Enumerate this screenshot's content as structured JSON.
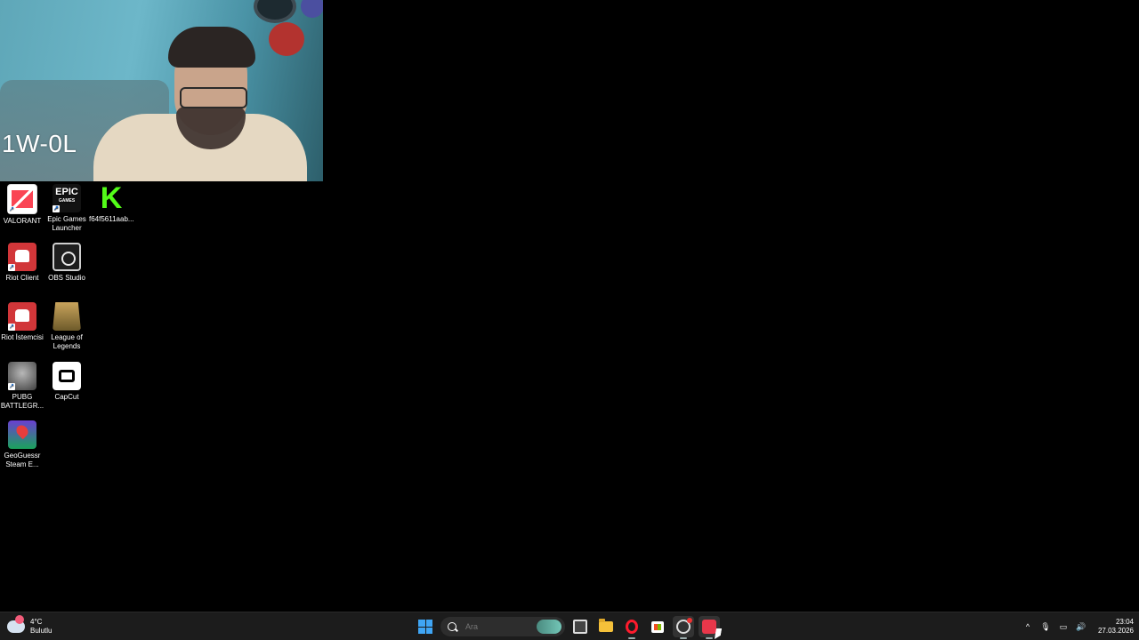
{
  "webcam": {
    "score_text": "1W-0L"
  },
  "desktop": {
    "icons": [
      {
        "label": "VALORANT",
        "icon": "valorant-icon"
      },
      {
        "label": "Epic Games Launcher",
        "icon": "epic-games-icon",
        "glyph": "EPIC",
        "subglyph": "GAMES"
      },
      {
        "label": "f64f5611aab...",
        "icon": "kick-icon",
        "glyph": "K"
      },
      {
        "label": "Riot Client",
        "icon": "riot-client-icon"
      },
      {
        "label": "OBS Studio",
        "icon": "obs-studio-icon"
      },
      {
        "label": "Riot İstemcisi",
        "icon": "riot-client-icon"
      },
      {
        "label": "League of Legends",
        "icon": "league-of-legends-icon"
      },
      {
        "label": "PUBG BATTLEGR...",
        "icon": "pubg-icon"
      },
      {
        "label": "CapCut",
        "icon": "capcut-icon"
      },
      {
        "label": "GeoGuessr Steam E...",
        "icon": "geoguessr-icon"
      }
    ]
  },
  "taskbar": {
    "weather": {
      "temp": "4°C",
      "condition": "Bulutlu"
    },
    "search": {
      "placeholder": "Ara"
    },
    "apps": [
      "start-button",
      "search",
      "task-view",
      "file-explorer",
      "opera",
      "microsoft-store",
      "obs-studio",
      "valorant"
    ],
    "clock": {
      "time": "23:04",
      "date": "27.03.2026"
    },
    "tray": {
      "chevron": "^",
      "mic": "🎙",
      "network": "▭",
      "volume": "🔊"
    }
  },
  "colors": {
    "taskbar_bg": "#1c1c1c",
    "desktop_bg": "#000000",
    "windows_blue": "#3fa5f4",
    "opera_red": "#ff1b2d",
    "kick_green": "#53fc18"
  }
}
